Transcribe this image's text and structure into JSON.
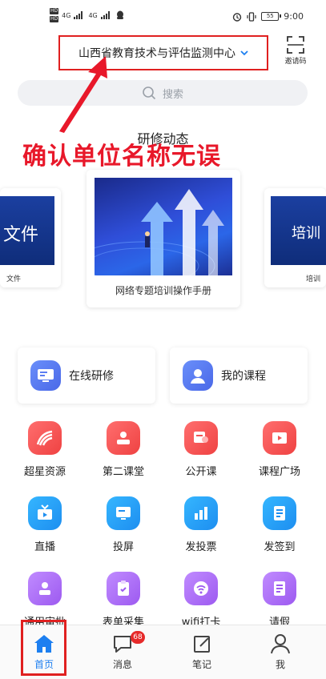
{
  "status_bar": {
    "time": "9:00",
    "network": [
      "HD",
      "4G",
      "HD",
      "4G"
    ],
    "battery": "55"
  },
  "header": {
    "org_name": "山西省教育技术与评估监测中心",
    "invite_label": "邀请码"
  },
  "search": {
    "placeholder": "搜索"
  },
  "annotation": {
    "text": "确认单位名称无误"
  },
  "section": {
    "title": "研修动态"
  },
  "carousel": {
    "main_caption": "网络专题培训操作手册",
    "left_image_text": "文件",
    "left_caption": "文件",
    "right_image_text": "培训",
    "right_caption": "培训"
  },
  "quick_actions": [
    {
      "label": "在线研修",
      "icon": "online-study-icon"
    },
    {
      "label": "我的课程",
      "icon": "my-courses-icon"
    }
  ],
  "grid": [
    {
      "label": "超星资源",
      "icon": "chaoxing-resource-icon",
      "color": "#f25454"
    },
    {
      "label": "第二课堂",
      "icon": "second-classroom-icon",
      "color": "#f25454"
    },
    {
      "label": "公开课",
      "icon": "open-class-icon",
      "color": "#f25454"
    },
    {
      "label": "课程广场",
      "icon": "course-square-icon",
      "color": "#f25454"
    },
    {
      "label": "直播",
      "icon": "live-icon",
      "color": "#2a9ff5"
    },
    {
      "label": "投屏",
      "icon": "screencast-icon",
      "color": "#2a9ff5"
    },
    {
      "label": "发投票",
      "icon": "vote-icon",
      "color": "#2a9ff5"
    },
    {
      "label": "发签到",
      "icon": "sign-in-icon",
      "color": "#2a9ff5"
    },
    {
      "label": "通用审批",
      "icon": "approval-icon",
      "color": "#ab6ff5"
    },
    {
      "label": "表单采集",
      "icon": "form-collect-icon",
      "color": "#ab6ff5"
    },
    {
      "label": "wifi打卡",
      "icon": "wifi-checkin-icon",
      "color": "#ab6ff5"
    },
    {
      "label": "请假",
      "icon": "leave-icon",
      "color": "#ab6ff5"
    }
  ],
  "bottom_nav": [
    {
      "label": "首页",
      "icon": "home-icon",
      "active": true
    },
    {
      "label": "消息",
      "icon": "message-icon",
      "badge": "68"
    },
    {
      "label": "笔记",
      "icon": "note-icon"
    },
    {
      "label": "我",
      "icon": "profile-icon"
    }
  ],
  "colors": {
    "accent": "#1d7ff0",
    "annotation_red": "#e8182a"
  }
}
